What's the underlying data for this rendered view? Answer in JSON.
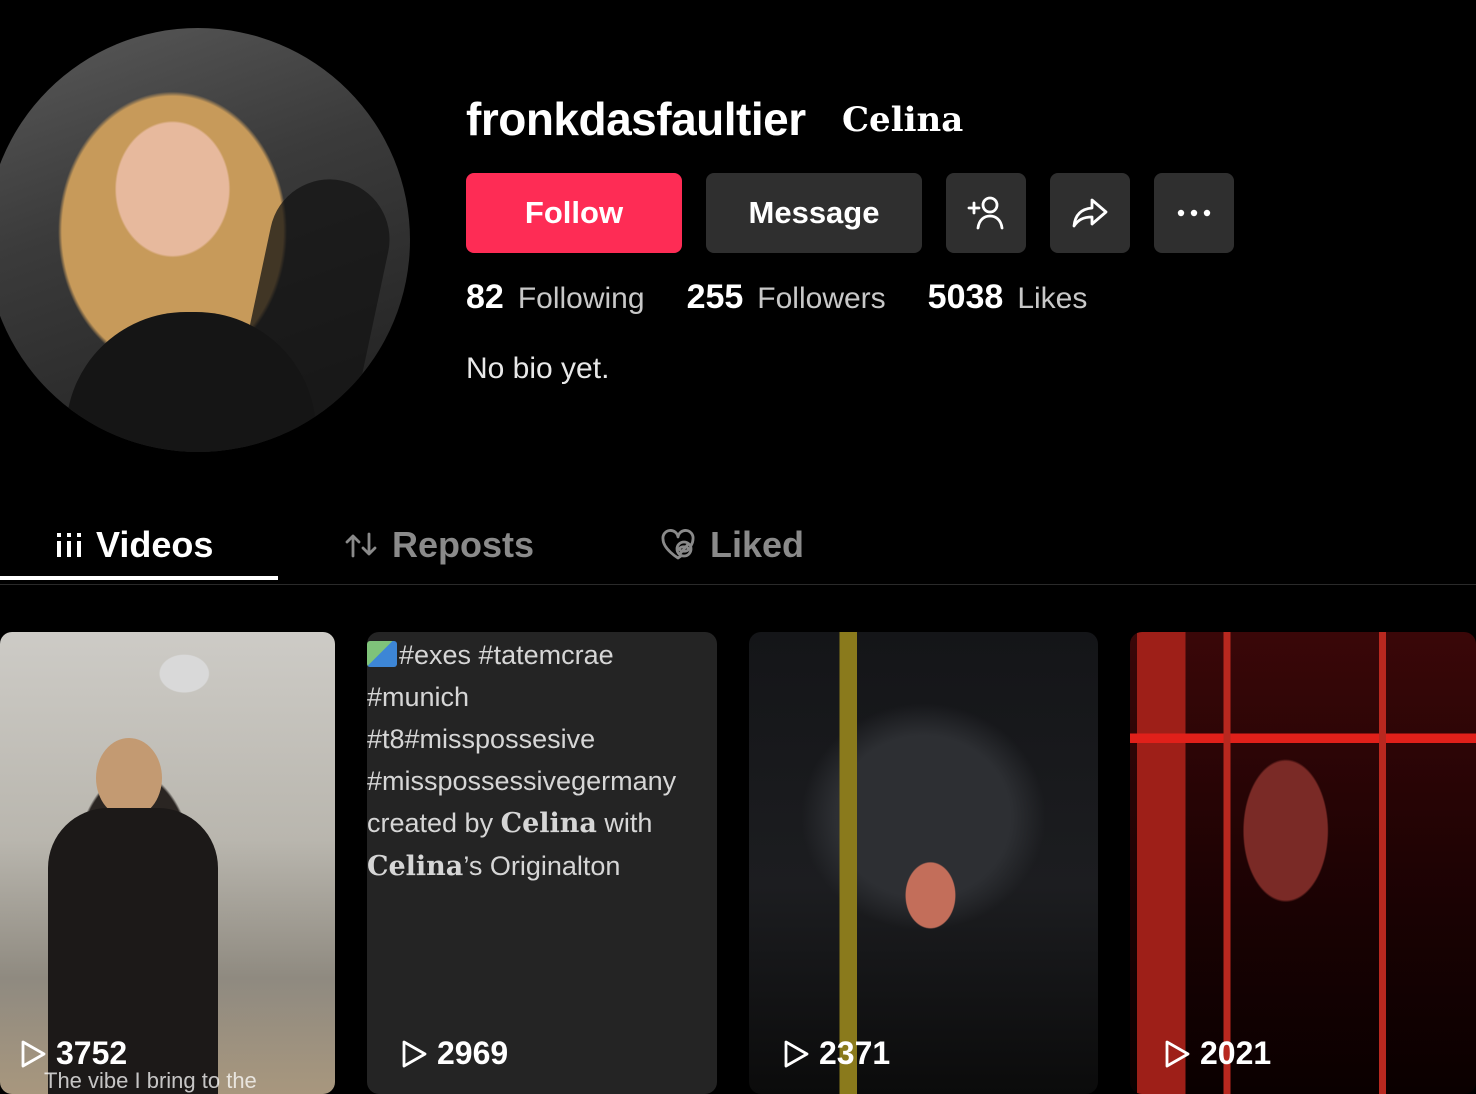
{
  "profile": {
    "username": "fronkdasfaultier",
    "nickname": "Celina",
    "bio": "No bio yet."
  },
  "actions": {
    "follow_label": "Follow",
    "message_label": "Message"
  },
  "stats": [
    {
      "value": "82",
      "label": "Following"
    },
    {
      "value": "255",
      "label": "Followers"
    },
    {
      "value": "5038",
      "label": "Likes"
    }
  ],
  "tabs": [
    {
      "label": "Videos",
      "active": true
    },
    {
      "label": "Reposts",
      "active": false
    },
    {
      "label": "Liked",
      "active": false
    }
  ],
  "videos": [
    {
      "views": "3752",
      "caption": "The vibe I bring to the"
    },
    {
      "views": "2969",
      "alt_lines": [
        "#exes #tatemcrae",
        "#munich",
        "#t8#misspossesive",
        "#misspossessivegermany"
      ],
      "alt_created_prefix": "created by ",
      "alt_created_name": "Celina",
      "alt_created_suffix": " with",
      "alt_sound_name": "Celina",
      "alt_sound_suffix": "’s Originalton"
    },
    {
      "views": "2371"
    },
    {
      "views": "2021"
    }
  ],
  "colors": {
    "background": "#000000",
    "follow_button": "#fe2c55",
    "secondary_button": "#2f2f2f"
  }
}
